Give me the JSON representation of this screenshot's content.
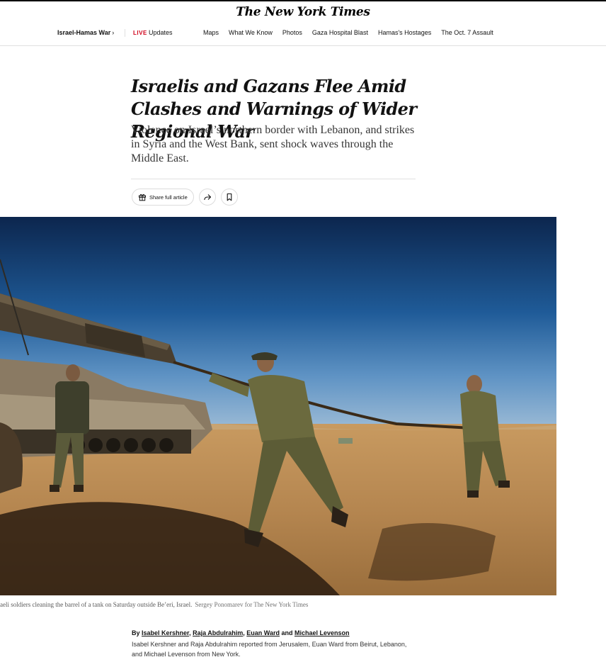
{
  "masthead": {
    "logo_text": "The New York Times"
  },
  "nav": {
    "section": "Israel-Hamas War",
    "chevron": "›",
    "live_badge": "LIVE",
    "live_label": "Updates",
    "links": [
      "Maps",
      "What We Know",
      "Photos",
      "Gaza Hospital Blast",
      "Hamas's Hostages",
      "The Oct. 7 Assault"
    ]
  },
  "article": {
    "headline": "Israelis and Gazans Flee Amid Clashes and Warnings of Wider Regional War",
    "summary": "Violence on Israel’s northern border with Lebanon, and strikes in Syria and the West Bank, sent shock waves through the Middle East.",
    "share_label": "Share full article",
    "share_icon": "gift-icon",
    "forward_icon": "share-arrow-icon",
    "save_icon": "bookmark-icon"
  },
  "photo": {
    "caption": "aeli soldiers cleaning the barrel of a tank on Saturday outside Be’eri, Israel.",
    "credit": "Sergey Ponomarev for The New York Times"
  },
  "byline": {
    "prefix": "By ",
    "authors": [
      "Isabel Kershner",
      "Raja Abdulrahim",
      "Euan Ward",
      "Michael Levenson"
    ],
    "sep1": ", ",
    "sep2": ", ",
    "sep3": " and ",
    "reported": "Isabel Kershner and Raja Abdulrahim reported from Jerusalem, Euan Ward from Beirut, Lebanon, and Michael Levenson from New York."
  },
  "colors": {
    "live": "#d0021b",
    "sky_top": "#0f2e5c",
    "sand": "#b98a52"
  }
}
